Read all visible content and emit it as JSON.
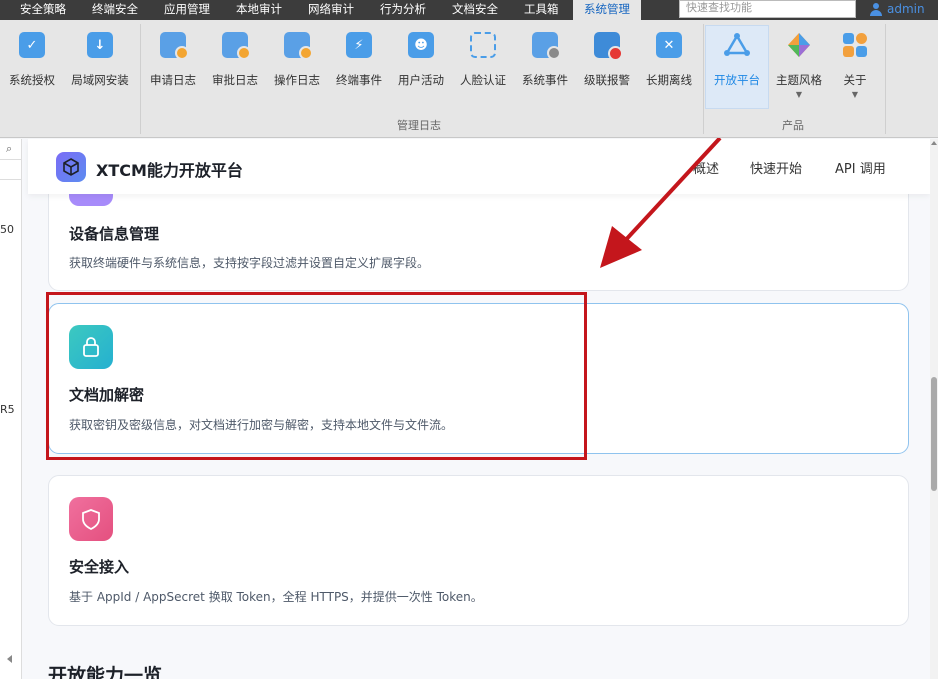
{
  "menubar": {
    "items": [
      "安全策略",
      "终端安全",
      "应用管理",
      "本地审计",
      "网络审计",
      "行为分析",
      "文档安全",
      "工具箱",
      "系统管理"
    ],
    "active_item": "系统管理",
    "search_placeholder": "快速查找功能",
    "user": "admin"
  },
  "ribbon": {
    "buttons": [
      {
        "label": "系统授权",
        "icon": "shield-icon"
      },
      {
        "label": "局域网安装",
        "icon": "download-icon"
      },
      {
        "label": "申请日志",
        "icon": "request-log-icon"
      },
      {
        "label": "审批日志",
        "icon": "approval-log-icon"
      },
      {
        "label": "操作日志",
        "icon": "operation-log-icon"
      },
      {
        "label": "终端事件",
        "icon": "lightning-icon"
      },
      {
        "label": "用户活动",
        "icon": "user-card-icon"
      },
      {
        "label": "人脸认证",
        "icon": "face-scan-icon"
      },
      {
        "label": "系统事件",
        "icon": "system-event-icon"
      },
      {
        "label": "级联报警",
        "icon": "cascade-alarm-icon"
      },
      {
        "label": "长期离线",
        "icon": "offline-icon"
      },
      {
        "label": "开放平台",
        "icon": "open-platform-icon"
      },
      {
        "label": "主题风格",
        "icon": "theme-icon"
      },
      {
        "label": "关于",
        "icon": "about-icon"
      }
    ],
    "active_button": "开放平台",
    "groups": {
      "management_log": "管理日志",
      "product": "产品"
    }
  },
  "left_strip": {
    "row_values": [
      "50",
      "R5"
    ]
  },
  "navbar": {
    "brand": "XTCM能力开放平台",
    "links": [
      "概述",
      "快速开始",
      "API 调用"
    ]
  },
  "cards": [
    {
      "title": "设备信息管理",
      "desc": "获取终端硬件与系统信息，支持按字段过滤并设置自定义扩展字段。",
      "icon": "device-icon",
      "color": "#a78bfa"
    },
    {
      "title": "文档加解密",
      "desc": "获取密钥及密级信息，对文档进行加密与解密，支持本地文件与文件流。",
      "icon": "lock-icon",
      "color": "#2ec4c4"
    },
    {
      "title": "安全接入",
      "desc": "基于 AppId / AppSecret 换取 Token，全程 HTTPS，并提供一次性 Token。",
      "icon": "shield-outline-icon",
      "color": "#ec5c8f"
    }
  ],
  "section_title": "开放能力一览",
  "colors": {
    "accent": "#1e88e5",
    "annotation_red": "#c4161c",
    "highlight_border": "#8fc3ee"
  }
}
